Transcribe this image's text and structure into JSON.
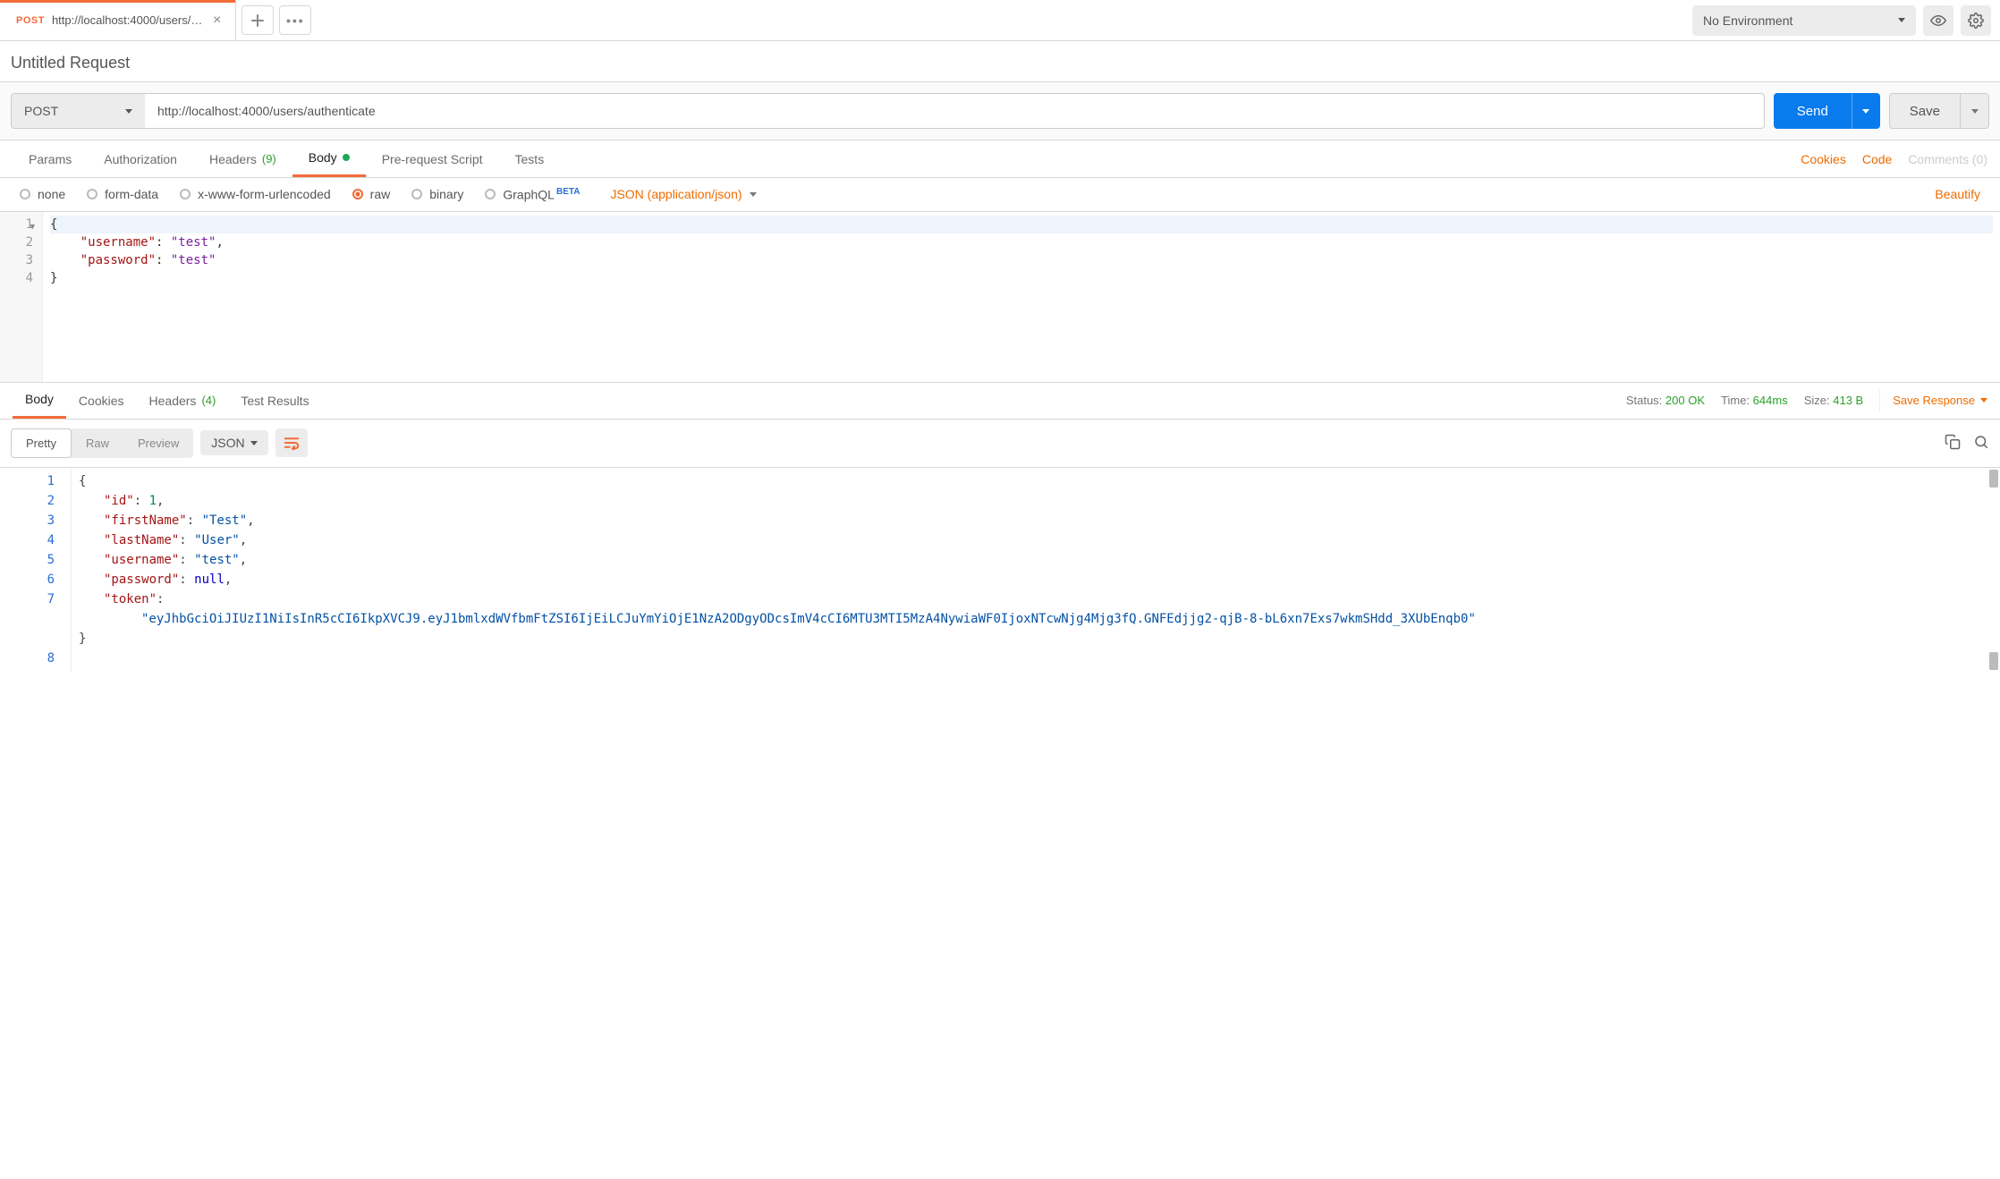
{
  "tab": {
    "method": "POST",
    "title": "http://localhost:4000/users/a..."
  },
  "environment": {
    "label": "No Environment"
  },
  "request_title": "Untitled Request",
  "url_bar": {
    "method": "POST",
    "url": "http://localhost:4000/users/authenticate",
    "send": "Send",
    "save": "Save"
  },
  "req_tabs": {
    "params": "Params",
    "authorization": "Authorization",
    "headers": "Headers",
    "headers_count": "(9)",
    "body": "Body",
    "prerequest": "Pre-request Script",
    "tests": "Tests",
    "cookies": "Cookies",
    "code": "Code",
    "comments": "Comments (0)"
  },
  "body_modes": {
    "none": "none",
    "formdata": "form-data",
    "xwww": "x-www-form-urlencoded",
    "raw": "raw",
    "binary": "binary",
    "graphql": "GraphQL",
    "graphql_badge": "BETA",
    "content_type": "JSON (application/json)",
    "beautify": "Beautify"
  },
  "request_body_lines": {
    "l1": "{",
    "l2_key": "\"username\"",
    "l2_val": "\"test\"",
    "l3_key": "\"password\"",
    "l3_val": "\"test\"",
    "l4": "}"
  },
  "response": {
    "tabs": {
      "body": "Body",
      "cookies": "Cookies",
      "headers": "Headers",
      "headers_count": "(4)",
      "test_results": "Test Results"
    },
    "status_label": "Status:",
    "status_value": "200 OK",
    "time_label": "Time:",
    "time_value": "644ms",
    "size_label": "Size:",
    "size_value": "413 B",
    "save_response": "Save Response",
    "view_tabs": {
      "pretty": "Pretty",
      "raw": "Raw",
      "preview": "Preview"
    },
    "format": "JSON"
  },
  "response_body": {
    "id_key": "\"id\"",
    "id_val": "1",
    "firstName_key": "\"firstName\"",
    "firstName_val": "\"Test\"",
    "lastName_key": "\"lastName\"",
    "lastName_val": "\"User\"",
    "username_key": "\"username\"",
    "username_val": "\"test\"",
    "password_key": "\"password\"",
    "password_val": "null",
    "token_key": "\"token\"",
    "token_val": "\"eyJhbGciOiJIUzI1NiIsInR5cCI6IkpXVCJ9.eyJ1bmlxdWVfbmFtZSI6IjEiLCJuYmYiOjE1NzA2ODgyODcsImV4cCI6MTU3MTI5MzA4NywiaWF0IjoxNTcwNjg4Mjg3fQ.GNFEdjjg2-qjB-8-bL6xn7Exs7wkmSHdd_3XUbEnqb0\""
  }
}
